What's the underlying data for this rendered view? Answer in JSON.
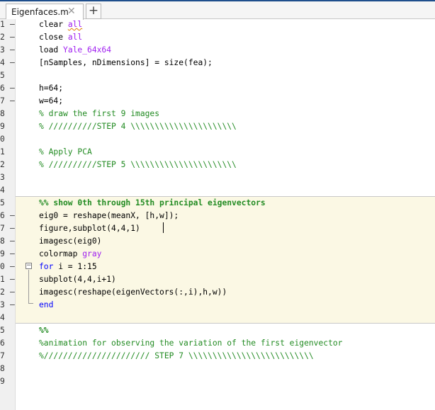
{
  "tab": {
    "label": "Eigenfaces.m",
    "close_glyph": "✕",
    "add_glyph": "+"
  },
  "lines": [
    {
      "num": "1",
      "marker": "–",
      "tokens": [
        {
          "t": "clear ",
          "c": "plain"
        },
        {
          "t": "all",
          "c": "str-squig"
        }
      ]
    },
    {
      "num": "2",
      "marker": "–",
      "tokens": [
        {
          "t": "close ",
          "c": "plain"
        },
        {
          "t": "all",
          "c": "str"
        }
      ]
    },
    {
      "num": "3",
      "marker": "–",
      "tokens": [
        {
          "t": "load ",
          "c": "plain"
        },
        {
          "t": "Yale_64x64",
          "c": "str"
        }
      ]
    },
    {
      "num": "4",
      "marker": "–",
      "tokens": [
        {
          "t": "[nSamples, nDimensions] = size(fea);",
          "c": "plain"
        }
      ]
    },
    {
      "num": "5",
      "marker": "",
      "tokens": []
    },
    {
      "num": "6",
      "marker": "–",
      "tokens": [
        {
          "t": "h=64;",
          "c": "plain"
        }
      ]
    },
    {
      "num": "7",
      "marker": "–",
      "tokens": [
        {
          "t": "w=64;",
          "c": "plain"
        }
      ]
    },
    {
      "num": "8",
      "marker": "",
      "tokens": [
        {
          "t": "% draw the first 9 images",
          "c": "cm"
        }
      ]
    },
    {
      "num": "9",
      "marker": "",
      "tokens": [
        {
          "t": "% //////////STEP 4 \\\\\\\\\\\\\\\\\\\\\\\\\\\\\\\\\\\\\\\\\\\\",
          "c": "cm"
        }
      ]
    },
    {
      "num": "0",
      "marker": "",
      "tokens": []
    },
    {
      "num": "1",
      "marker": "",
      "tokens": [
        {
          "t": "% Apply PCA",
          "c": "cm"
        }
      ]
    },
    {
      "num": "2",
      "marker": "",
      "tokens": [
        {
          "t": "% //////////STEP 5 \\\\\\\\\\\\\\\\\\\\\\\\\\\\\\\\\\\\\\\\\\\\",
          "c": "cm"
        }
      ]
    },
    {
      "num": "3",
      "marker": "",
      "tokens": []
    },
    {
      "num": "4",
      "marker": "",
      "tokens": []
    },
    {
      "num": "5",
      "marker": "",
      "tokens": [
        {
          "t": "%% show 0th through 15th principal eigenvectors",
          "c": "cellhd"
        }
      ]
    },
    {
      "num": "6",
      "marker": "–",
      "tokens": [
        {
          "t": "eig0 = reshape(meanX, [h,w]);",
          "c": "plain"
        }
      ]
    },
    {
      "num": "7",
      "marker": "–",
      "tokens": [
        {
          "t": "figure,subplot(4,4,1)",
          "c": "plain"
        }
      ]
    },
    {
      "num": "8",
      "marker": "–",
      "tokens": [
        {
          "t": "imagesc(eig0)",
          "c": "plain"
        }
      ]
    },
    {
      "num": "9",
      "marker": "–",
      "tokens": [
        {
          "t": "colormap ",
          "c": "plain"
        },
        {
          "t": "gray",
          "c": "str"
        }
      ]
    },
    {
      "num": "0",
      "marker": "–",
      "tokens": [
        {
          "t": "for",
          "c": "kw"
        },
        {
          "t": " i = 1:15",
          "c": "plain"
        }
      ]
    },
    {
      "num": "1",
      "marker": "–",
      "tokens": [
        {
          "t": "subplot(4,4,i+1)",
          "c": "plain"
        }
      ]
    },
    {
      "num": "2",
      "marker": "–",
      "tokens": [
        {
          "t": "imagesc(reshape(eigenVectors(:,i),h,w))",
          "c": "plain"
        }
      ]
    },
    {
      "num": "3",
      "marker": "–",
      "tokens": [
        {
          "t": "end",
          "c": "kw"
        }
      ]
    },
    {
      "num": "4",
      "marker": "",
      "tokens": []
    },
    {
      "num": "5",
      "marker": "",
      "tokens": [
        {
          "t": "%%",
          "c": "cellhd"
        }
      ]
    },
    {
      "num": "6",
      "marker": "",
      "tokens": [
        {
          "t": "%animation for observing the variation of the first eigenvector",
          "c": "cm"
        }
      ]
    },
    {
      "num": "7",
      "marker": "",
      "tokens": [
        {
          "t": "%////////////////////// STEP 7 \\\\\\\\\\\\\\\\\\\\\\\\\\\\\\\\\\\\\\\\\\\\\\\\\\\\",
          "c": "cm"
        }
      ]
    },
    {
      "num": "8",
      "marker": "",
      "tokens": []
    },
    {
      "num": "9",
      "marker": "",
      "tokens": []
    }
  ]
}
